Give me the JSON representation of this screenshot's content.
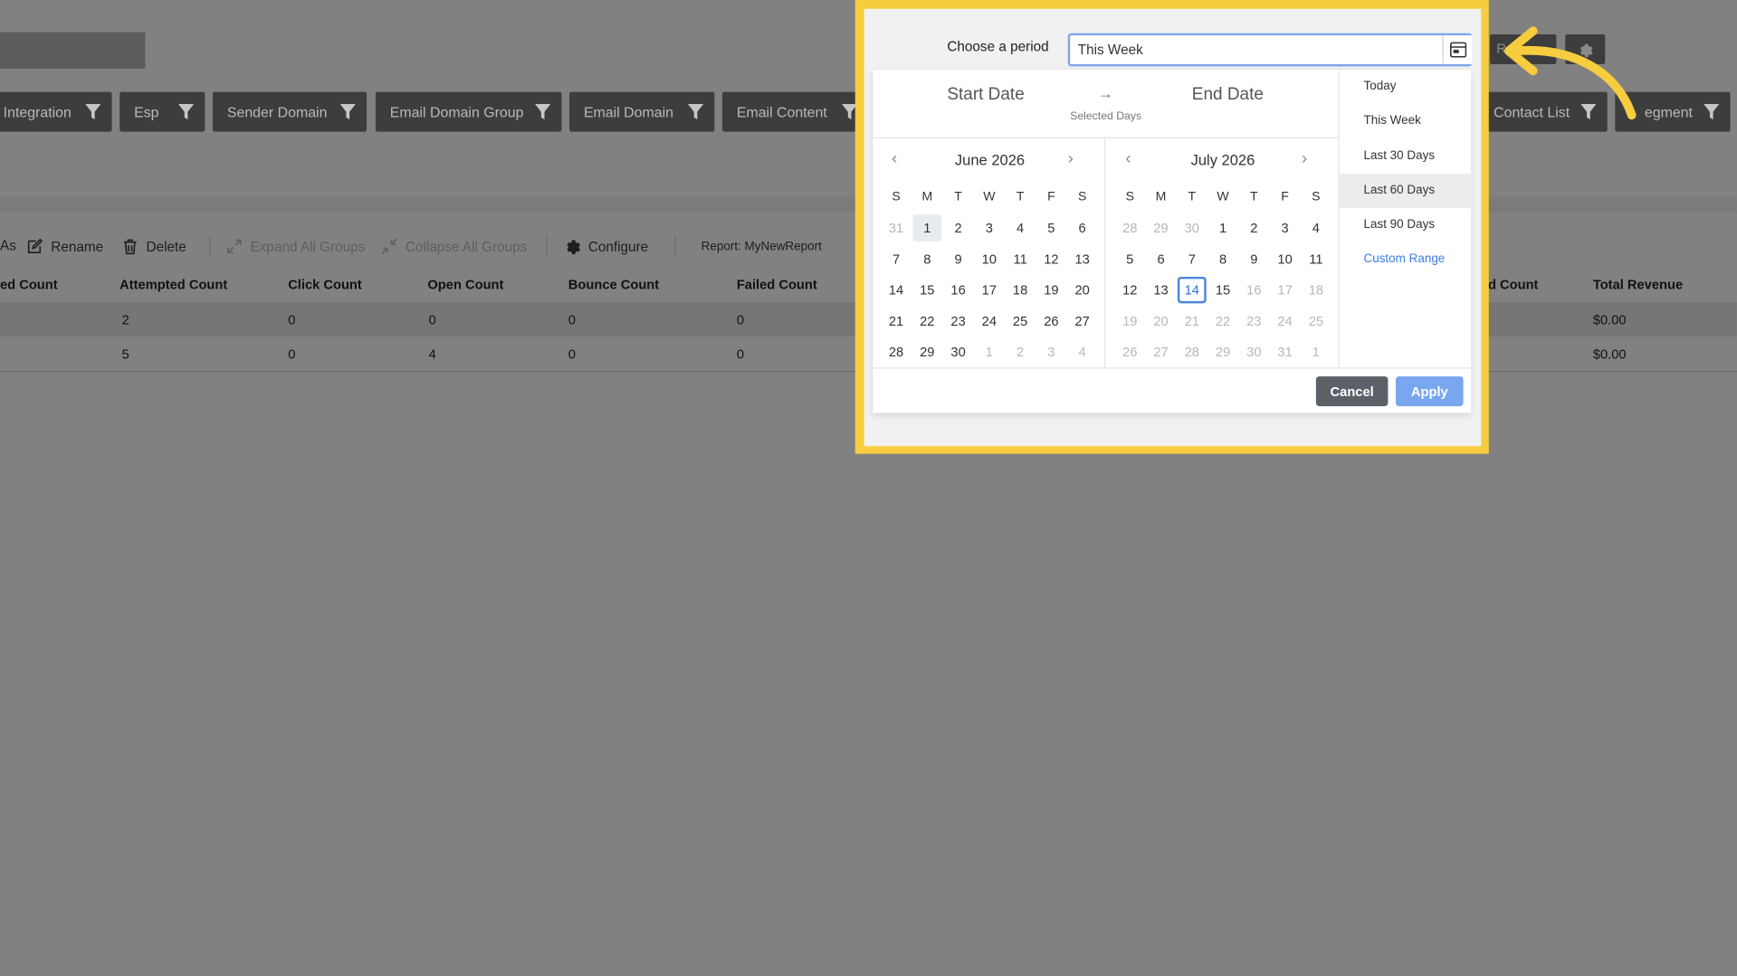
{
  "filters": [
    {
      "label": "Integration"
    },
    {
      "label": "Esp"
    },
    {
      "label": "Sender Domain"
    },
    {
      "label": "Email Domain Group"
    },
    {
      "label": "Email Domain"
    },
    {
      "label": "Email Content"
    },
    {
      "label": "Contact List"
    },
    {
      "label": "egment"
    }
  ],
  "ghost_button_text": "R",
  "toolbar": {
    "as_fragment": "As",
    "rename": "Rename",
    "delete": "Delete",
    "expand_all": "Expand All Groups",
    "collapse_all": "Collapse All Groups",
    "configure": "Configure",
    "report": "Report: MyNewReport"
  },
  "table": {
    "headers": [
      "ed Count",
      "Attempted Count",
      "Click Count",
      "Open Count",
      "Bounce Count",
      "Failed Count",
      "i  ed Count",
      "Total Revenue"
    ],
    "rows": [
      {
        "attempted": "2",
        "click": "0",
        "open": "0",
        "bounce": "0",
        "failed": "0",
        "revenue": "$0.00"
      },
      {
        "attempted": "5",
        "click": "0",
        "open": "4",
        "bounce": "0",
        "failed": "0",
        "revenue": "$0.00"
      }
    ]
  },
  "period": {
    "label": "Choose a period",
    "value": "This Week"
  },
  "picker": {
    "start_label": "Start Date",
    "end_label": "End Date",
    "arrow": "→",
    "selected_days_label": "Selected Days",
    "weekdays": [
      "S",
      "M",
      "T",
      "W",
      "T",
      "F",
      "S"
    ],
    "left_month": {
      "title": "June 2026",
      "prev": "‹",
      "next": "›",
      "days": [
        "31",
        "1",
        "2",
        "3",
        "4",
        "5",
        "6",
        "7",
        "8",
        "9",
        "10",
        "11",
        "12",
        "13",
        "14",
        "15",
        "16",
        "17",
        "18",
        "19",
        "20",
        "21",
        "22",
        "23",
        "24",
        "25",
        "26",
        "27",
        "28",
        "29",
        "30",
        "1",
        "2",
        "3",
        "4"
      ],
      "muted": [
        0,
        31,
        32,
        33,
        34
      ],
      "highlight": 1
    },
    "right_month": {
      "title": "July 2026",
      "prev": "‹",
      "next": "›",
      "days": [
        "28",
        "29",
        "30",
        "1",
        "2",
        "3",
        "4",
        "5",
        "6",
        "7",
        "8",
        "9",
        "10",
        "11",
        "12",
        "13",
        "14",
        "15",
        "16",
        "17",
        "18",
        "19",
        "20",
        "21",
        "22",
        "23",
        "24",
        "25",
        "26",
        "27",
        "28",
        "29",
        "30",
        "31",
        "1"
      ],
      "muted_from": 17,
      "muted_prefix": [
        0,
        1,
        2
      ],
      "today": 16
    },
    "presets": [
      {
        "label": "Today"
      },
      {
        "label": "This Week"
      },
      {
        "label": "Last 30 Days"
      },
      {
        "label": "Last 60 Days",
        "active": true
      },
      {
        "label": "Last 90 Days"
      },
      {
        "label": "Custom Range",
        "custom": true
      }
    ],
    "cancel": "Cancel",
    "apply": "Apply"
  },
  "colors": {
    "highlight_frame": "#f6cd3f",
    "apply_button": "#79a7ef",
    "today_border": "#4c86d8",
    "custom_range": "#3c7fe0"
  }
}
